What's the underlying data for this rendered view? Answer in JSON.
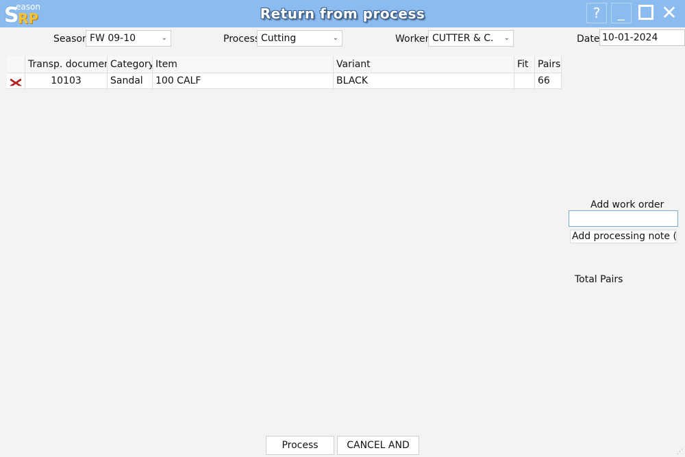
{
  "app": {
    "logo_small": "eason",
    "logo_s": "S",
    "logo_rp": "RP",
    "title": "Return from process",
    "help_glyph": "?",
    "minimize_glyph": "_",
    "close_glyph": "✕"
  },
  "filters": {
    "season_label": "Season",
    "season_value": "FW 09-10",
    "process_label": "Process",
    "process_value": "Cutting",
    "worker_label": "Worker",
    "worker_value": "CUTTER & C.",
    "date_label": "Date",
    "date_value": "10-01-2024",
    "dropdown_glyph": "⌄"
  },
  "table": {
    "columns": [
      "",
      "Transp. document",
      "Category",
      "Item",
      "Variant",
      "Fit",
      "Pairs"
    ],
    "rows": [
      {
        "document": "10103",
        "category": "Sandal",
        "item": "100 CALF",
        "variant": "BLACK",
        "fit": "",
        "pairs": "66"
      }
    ],
    "delete_icon": "delete-x-icon",
    "delete_color": "#d42020"
  },
  "side": {
    "add_work_order_label": "Add work order",
    "add_work_order_value": "",
    "add_note_label": "Add processing note (R=",
    "total_pairs_label": "Total Pairs"
  },
  "actions": {
    "process_label": "Process",
    "cancel_label": "CANCEL AND EXIT"
  },
  "colors": {
    "titlebar": "#8cbcef",
    "background": "#f3f3f3",
    "input_focus_border": "#7aaed8"
  }
}
